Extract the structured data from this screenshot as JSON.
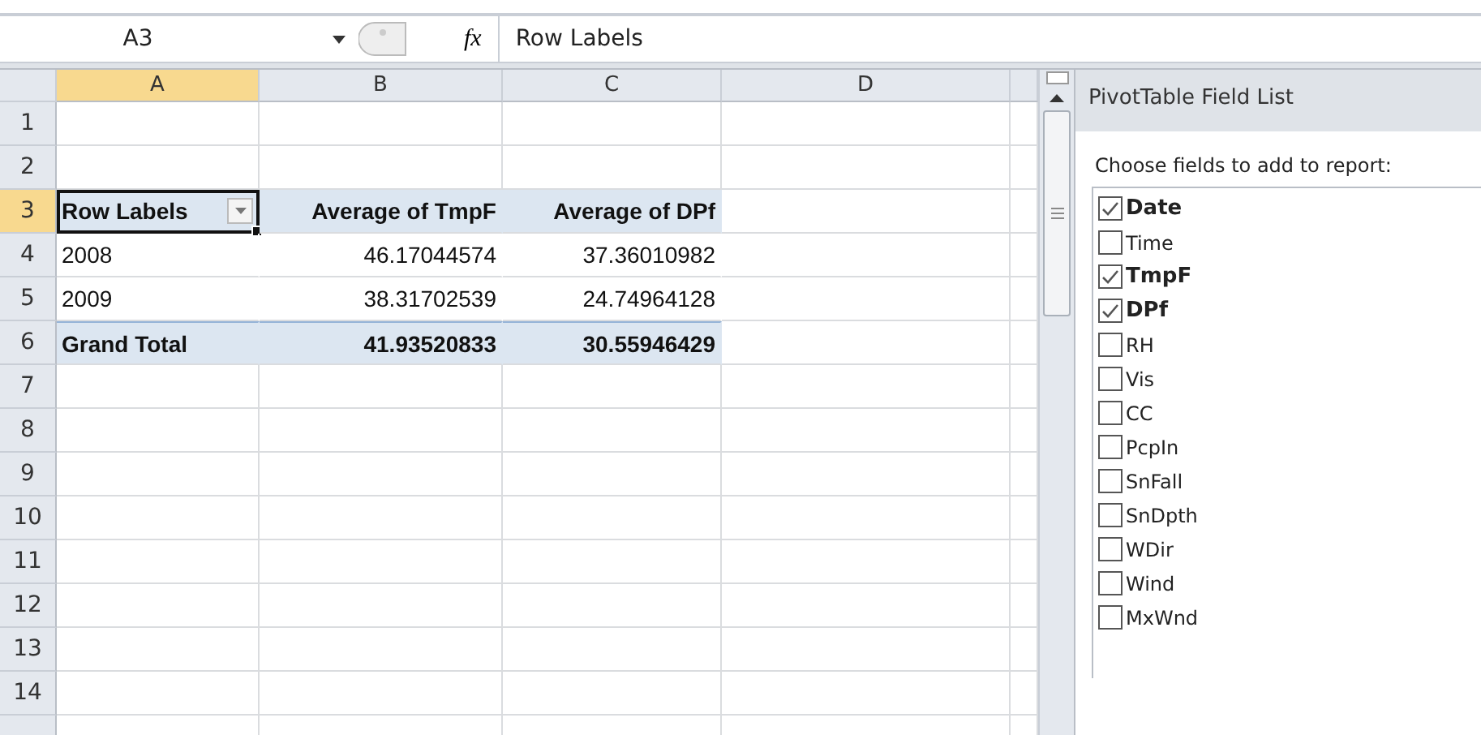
{
  "formula_bar": {
    "name_box": "A3",
    "function_label": "fx",
    "formula": "Row Labels"
  },
  "columns": [
    {
      "label": "A",
      "selected": true
    },
    {
      "label": "B",
      "selected": false
    },
    {
      "label": "C",
      "selected": false
    },
    {
      "label": "D",
      "selected": false
    }
  ],
  "rows": [
    {
      "number": "1",
      "selected": false,
      "kind": "empty",
      "cells": []
    },
    {
      "number": "2",
      "selected": false,
      "kind": "empty",
      "cells": []
    },
    {
      "number": "3",
      "selected": true,
      "kind": "pivot_header",
      "cells": [
        "Row Labels",
        "Average of TmpF",
        "Average of DPf"
      ]
    },
    {
      "number": "4",
      "selected": false,
      "kind": "data",
      "cells": [
        "2008",
        "46.17044574",
        "37.36010982"
      ]
    },
    {
      "number": "5",
      "selected": false,
      "kind": "data",
      "cells": [
        "2009",
        "38.31702539",
        "24.74964128"
      ]
    },
    {
      "number": "6",
      "selected": false,
      "kind": "total",
      "cells": [
        "Grand Total",
        "41.93520833",
        "30.55946429"
      ]
    },
    {
      "number": "7",
      "selected": false,
      "kind": "empty",
      "cells": []
    },
    {
      "number": "8",
      "selected": false,
      "kind": "empty",
      "cells": []
    },
    {
      "number": "9",
      "selected": false,
      "kind": "empty",
      "cells": []
    },
    {
      "number": "10",
      "selected": false,
      "kind": "empty",
      "cells": []
    },
    {
      "number": "11",
      "selected": false,
      "kind": "empty",
      "cells": []
    },
    {
      "number": "12",
      "selected": false,
      "kind": "empty",
      "cells": []
    },
    {
      "number": "13",
      "selected": false,
      "kind": "empty",
      "cells": []
    },
    {
      "number": "14",
      "selected": false,
      "kind": "empty",
      "cells": []
    }
  ],
  "field_list": {
    "title": "PivotTable Field List",
    "prompt": "Choose fields to add to report:",
    "fields": [
      {
        "name": "Date",
        "checked": true
      },
      {
        "name": "Time",
        "checked": false
      },
      {
        "name": "TmpF",
        "checked": true
      },
      {
        "name": "DPf",
        "checked": true
      },
      {
        "name": "RH",
        "checked": false
      },
      {
        "name": "Vis",
        "checked": false
      },
      {
        "name": "CC",
        "checked": false
      },
      {
        "name": "PcpIn",
        "checked": false
      },
      {
        "name": "SnFall",
        "checked": false
      },
      {
        "name": "SnDpth",
        "checked": false
      },
      {
        "name": "WDir",
        "checked": false
      },
      {
        "name": "Wind",
        "checked": false
      },
      {
        "name": "MxWnd",
        "checked": false
      }
    ]
  }
}
